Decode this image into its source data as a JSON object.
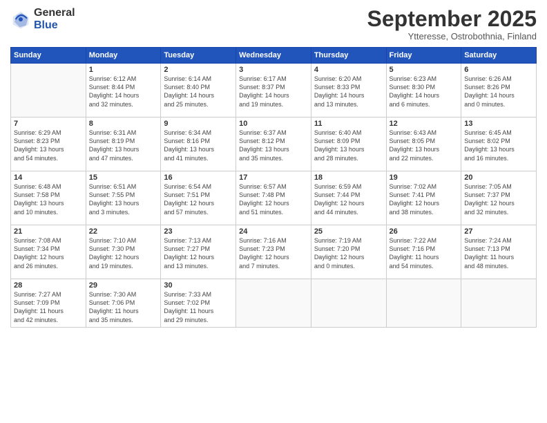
{
  "logo": {
    "general": "General",
    "blue": "Blue"
  },
  "header": {
    "month": "September 2025",
    "location": "Ytteresse, Ostrobothnia, Finland"
  },
  "weekdays": [
    "Sunday",
    "Monday",
    "Tuesday",
    "Wednesday",
    "Thursday",
    "Friday",
    "Saturday"
  ],
  "weeks": [
    [
      {
        "day": "",
        "info": ""
      },
      {
        "day": "1",
        "info": "Sunrise: 6:12 AM\nSunset: 8:44 PM\nDaylight: 14 hours\nand 32 minutes."
      },
      {
        "day": "2",
        "info": "Sunrise: 6:14 AM\nSunset: 8:40 PM\nDaylight: 14 hours\nand 25 minutes."
      },
      {
        "day": "3",
        "info": "Sunrise: 6:17 AM\nSunset: 8:37 PM\nDaylight: 14 hours\nand 19 minutes."
      },
      {
        "day": "4",
        "info": "Sunrise: 6:20 AM\nSunset: 8:33 PM\nDaylight: 14 hours\nand 13 minutes."
      },
      {
        "day": "5",
        "info": "Sunrise: 6:23 AM\nSunset: 8:30 PM\nDaylight: 14 hours\nand 6 minutes."
      },
      {
        "day": "6",
        "info": "Sunrise: 6:26 AM\nSunset: 8:26 PM\nDaylight: 14 hours\nand 0 minutes."
      }
    ],
    [
      {
        "day": "7",
        "info": "Sunrise: 6:29 AM\nSunset: 8:23 PM\nDaylight: 13 hours\nand 54 minutes."
      },
      {
        "day": "8",
        "info": "Sunrise: 6:31 AM\nSunset: 8:19 PM\nDaylight: 13 hours\nand 47 minutes."
      },
      {
        "day": "9",
        "info": "Sunrise: 6:34 AM\nSunset: 8:16 PM\nDaylight: 13 hours\nand 41 minutes."
      },
      {
        "day": "10",
        "info": "Sunrise: 6:37 AM\nSunset: 8:12 PM\nDaylight: 13 hours\nand 35 minutes."
      },
      {
        "day": "11",
        "info": "Sunrise: 6:40 AM\nSunset: 8:09 PM\nDaylight: 13 hours\nand 28 minutes."
      },
      {
        "day": "12",
        "info": "Sunrise: 6:43 AM\nSunset: 8:05 PM\nDaylight: 13 hours\nand 22 minutes."
      },
      {
        "day": "13",
        "info": "Sunrise: 6:45 AM\nSunset: 8:02 PM\nDaylight: 13 hours\nand 16 minutes."
      }
    ],
    [
      {
        "day": "14",
        "info": "Sunrise: 6:48 AM\nSunset: 7:58 PM\nDaylight: 13 hours\nand 10 minutes."
      },
      {
        "day": "15",
        "info": "Sunrise: 6:51 AM\nSunset: 7:55 PM\nDaylight: 13 hours\nand 3 minutes."
      },
      {
        "day": "16",
        "info": "Sunrise: 6:54 AM\nSunset: 7:51 PM\nDaylight: 12 hours\nand 57 minutes."
      },
      {
        "day": "17",
        "info": "Sunrise: 6:57 AM\nSunset: 7:48 PM\nDaylight: 12 hours\nand 51 minutes."
      },
      {
        "day": "18",
        "info": "Sunrise: 6:59 AM\nSunset: 7:44 PM\nDaylight: 12 hours\nand 44 minutes."
      },
      {
        "day": "19",
        "info": "Sunrise: 7:02 AM\nSunset: 7:41 PM\nDaylight: 12 hours\nand 38 minutes."
      },
      {
        "day": "20",
        "info": "Sunrise: 7:05 AM\nSunset: 7:37 PM\nDaylight: 12 hours\nand 32 minutes."
      }
    ],
    [
      {
        "day": "21",
        "info": "Sunrise: 7:08 AM\nSunset: 7:34 PM\nDaylight: 12 hours\nand 26 minutes."
      },
      {
        "day": "22",
        "info": "Sunrise: 7:10 AM\nSunset: 7:30 PM\nDaylight: 12 hours\nand 19 minutes."
      },
      {
        "day": "23",
        "info": "Sunrise: 7:13 AM\nSunset: 7:27 PM\nDaylight: 12 hours\nand 13 minutes."
      },
      {
        "day": "24",
        "info": "Sunrise: 7:16 AM\nSunset: 7:23 PM\nDaylight: 12 hours\nand 7 minutes."
      },
      {
        "day": "25",
        "info": "Sunrise: 7:19 AM\nSunset: 7:20 PM\nDaylight: 12 hours\nand 0 minutes."
      },
      {
        "day": "26",
        "info": "Sunrise: 7:22 AM\nSunset: 7:16 PM\nDaylight: 11 hours\nand 54 minutes."
      },
      {
        "day": "27",
        "info": "Sunrise: 7:24 AM\nSunset: 7:13 PM\nDaylight: 11 hours\nand 48 minutes."
      }
    ],
    [
      {
        "day": "28",
        "info": "Sunrise: 7:27 AM\nSunset: 7:09 PM\nDaylight: 11 hours\nand 42 minutes."
      },
      {
        "day": "29",
        "info": "Sunrise: 7:30 AM\nSunset: 7:06 PM\nDaylight: 11 hours\nand 35 minutes."
      },
      {
        "day": "30",
        "info": "Sunrise: 7:33 AM\nSunset: 7:02 PM\nDaylight: 11 hours\nand 29 minutes."
      },
      {
        "day": "",
        "info": ""
      },
      {
        "day": "",
        "info": ""
      },
      {
        "day": "",
        "info": ""
      },
      {
        "day": "",
        "info": ""
      }
    ]
  ]
}
